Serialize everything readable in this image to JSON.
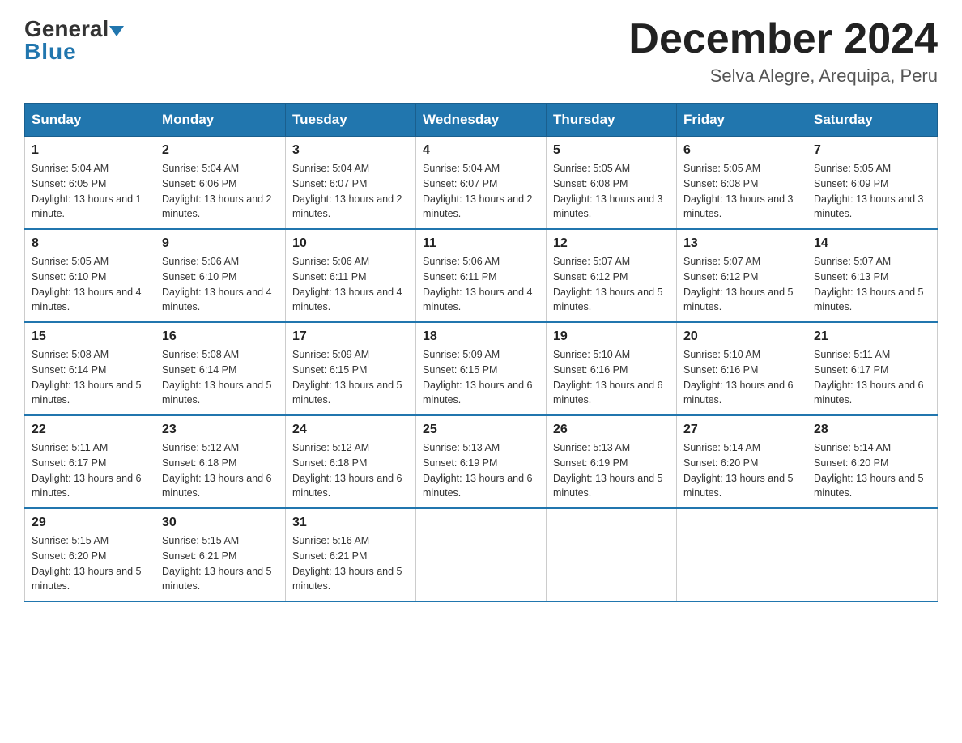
{
  "logo": {
    "general": "General",
    "arrow": "▶",
    "blue": "Blue"
  },
  "header": {
    "title": "December 2024",
    "location": "Selva Alegre, Arequipa, Peru"
  },
  "days_of_week": [
    "Sunday",
    "Monday",
    "Tuesday",
    "Wednesday",
    "Thursday",
    "Friday",
    "Saturday"
  ],
  "weeks": [
    [
      {
        "day": "1",
        "sunrise": "5:04 AM",
        "sunset": "6:05 PM",
        "daylight": "13 hours and 1 minute."
      },
      {
        "day": "2",
        "sunrise": "5:04 AM",
        "sunset": "6:06 PM",
        "daylight": "13 hours and 2 minutes."
      },
      {
        "day": "3",
        "sunrise": "5:04 AM",
        "sunset": "6:07 PM",
        "daylight": "13 hours and 2 minutes."
      },
      {
        "day": "4",
        "sunrise": "5:04 AM",
        "sunset": "6:07 PM",
        "daylight": "13 hours and 2 minutes."
      },
      {
        "day": "5",
        "sunrise": "5:05 AM",
        "sunset": "6:08 PM",
        "daylight": "13 hours and 3 minutes."
      },
      {
        "day": "6",
        "sunrise": "5:05 AM",
        "sunset": "6:08 PM",
        "daylight": "13 hours and 3 minutes."
      },
      {
        "day": "7",
        "sunrise": "5:05 AM",
        "sunset": "6:09 PM",
        "daylight": "13 hours and 3 minutes."
      }
    ],
    [
      {
        "day": "8",
        "sunrise": "5:05 AM",
        "sunset": "6:10 PM",
        "daylight": "13 hours and 4 minutes."
      },
      {
        "day": "9",
        "sunrise": "5:06 AM",
        "sunset": "6:10 PM",
        "daylight": "13 hours and 4 minutes."
      },
      {
        "day": "10",
        "sunrise": "5:06 AM",
        "sunset": "6:11 PM",
        "daylight": "13 hours and 4 minutes."
      },
      {
        "day": "11",
        "sunrise": "5:06 AM",
        "sunset": "6:11 PM",
        "daylight": "13 hours and 4 minutes."
      },
      {
        "day": "12",
        "sunrise": "5:07 AM",
        "sunset": "6:12 PM",
        "daylight": "13 hours and 5 minutes."
      },
      {
        "day": "13",
        "sunrise": "5:07 AM",
        "sunset": "6:12 PM",
        "daylight": "13 hours and 5 minutes."
      },
      {
        "day": "14",
        "sunrise": "5:07 AM",
        "sunset": "6:13 PM",
        "daylight": "13 hours and 5 minutes."
      }
    ],
    [
      {
        "day": "15",
        "sunrise": "5:08 AM",
        "sunset": "6:14 PM",
        "daylight": "13 hours and 5 minutes."
      },
      {
        "day": "16",
        "sunrise": "5:08 AM",
        "sunset": "6:14 PM",
        "daylight": "13 hours and 5 minutes."
      },
      {
        "day": "17",
        "sunrise": "5:09 AM",
        "sunset": "6:15 PM",
        "daylight": "13 hours and 5 minutes."
      },
      {
        "day": "18",
        "sunrise": "5:09 AM",
        "sunset": "6:15 PM",
        "daylight": "13 hours and 6 minutes."
      },
      {
        "day": "19",
        "sunrise": "5:10 AM",
        "sunset": "6:16 PM",
        "daylight": "13 hours and 6 minutes."
      },
      {
        "day": "20",
        "sunrise": "5:10 AM",
        "sunset": "6:16 PM",
        "daylight": "13 hours and 6 minutes."
      },
      {
        "day": "21",
        "sunrise": "5:11 AM",
        "sunset": "6:17 PM",
        "daylight": "13 hours and 6 minutes."
      }
    ],
    [
      {
        "day": "22",
        "sunrise": "5:11 AM",
        "sunset": "6:17 PM",
        "daylight": "13 hours and 6 minutes."
      },
      {
        "day": "23",
        "sunrise": "5:12 AM",
        "sunset": "6:18 PM",
        "daylight": "13 hours and 6 minutes."
      },
      {
        "day": "24",
        "sunrise": "5:12 AM",
        "sunset": "6:18 PM",
        "daylight": "13 hours and 6 minutes."
      },
      {
        "day": "25",
        "sunrise": "5:13 AM",
        "sunset": "6:19 PM",
        "daylight": "13 hours and 6 minutes."
      },
      {
        "day": "26",
        "sunrise": "5:13 AM",
        "sunset": "6:19 PM",
        "daylight": "13 hours and 5 minutes."
      },
      {
        "day": "27",
        "sunrise": "5:14 AM",
        "sunset": "6:20 PM",
        "daylight": "13 hours and 5 minutes."
      },
      {
        "day": "28",
        "sunrise": "5:14 AM",
        "sunset": "6:20 PM",
        "daylight": "13 hours and 5 minutes."
      }
    ],
    [
      {
        "day": "29",
        "sunrise": "5:15 AM",
        "sunset": "6:20 PM",
        "daylight": "13 hours and 5 minutes."
      },
      {
        "day": "30",
        "sunrise": "5:15 AM",
        "sunset": "6:21 PM",
        "daylight": "13 hours and 5 minutes."
      },
      {
        "day": "31",
        "sunrise": "5:16 AM",
        "sunset": "6:21 PM",
        "daylight": "13 hours and 5 minutes."
      },
      null,
      null,
      null,
      null
    ]
  ],
  "labels": {
    "sunrise": "Sunrise:",
    "sunset": "Sunset:",
    "daylight": "Daylight:"
  }
}
